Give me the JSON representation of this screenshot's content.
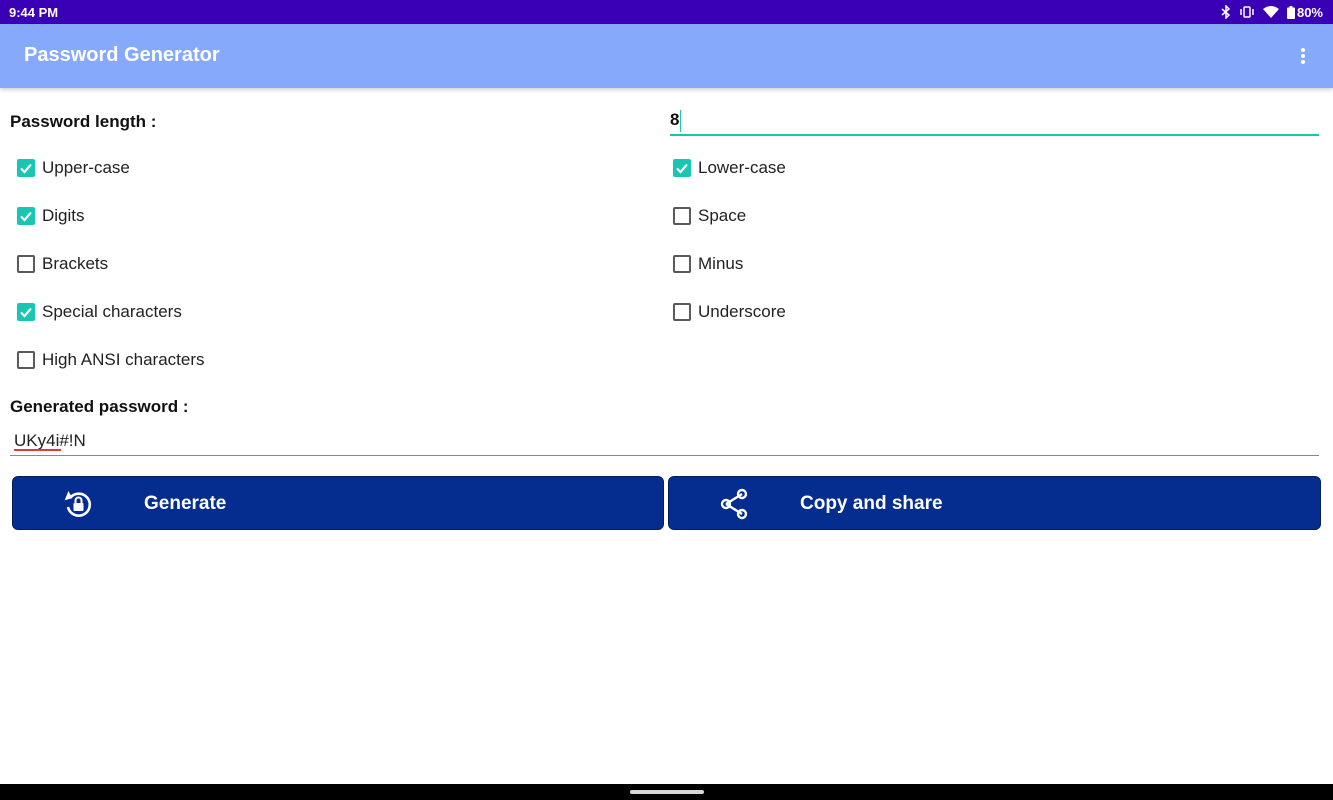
{
  "status_bar": {
    "time": "9:44 PM",
    "battery": "80%"
  },
  "app_bar": {
    "title": "Password Generator",
    "menu_icon": "more-vert-icon"
  },
  "form": {
    "password_length_label": "Password length :",
    "password_length_value": "8",
    "options": [
      {
        "label": "Upper-case",
        "checked": true
      },
      {
        "label": "Lower-case",
        "checked": true
      },
      {
        "label": "Digits",
        "checked": true
      },
      {
        "label": "Space",
        "checked": false
      },
      {
        "label": "Brackets",
        "checked": false
      },
      {
        "label": "Minus",
        "checked": false
      },
      {
        "label": "Special characters",
        "checked": true
      },
      {
        "label": "Underscore",
        "checked": false
      },
      {
        "label": "High ANSI characters",
        "checked": false
      }
    ],
    "generated_password_label": "Generated password :",
    "generated_password_value": "UKy4i#!N"
  },
  "buttons": {
    "generate_label": "Generate",
    "generate_icon": "lock-reset-icon",
    "share_label": "Copy and share",
    "share_icon": "share-icon"
  },
  "colors": {
    "status_bar": "#3a00b5",
    "app_bar": "#87a9fb",
    "accent": "#18c6b3",
    "button": "#052d8f"
  }
}
